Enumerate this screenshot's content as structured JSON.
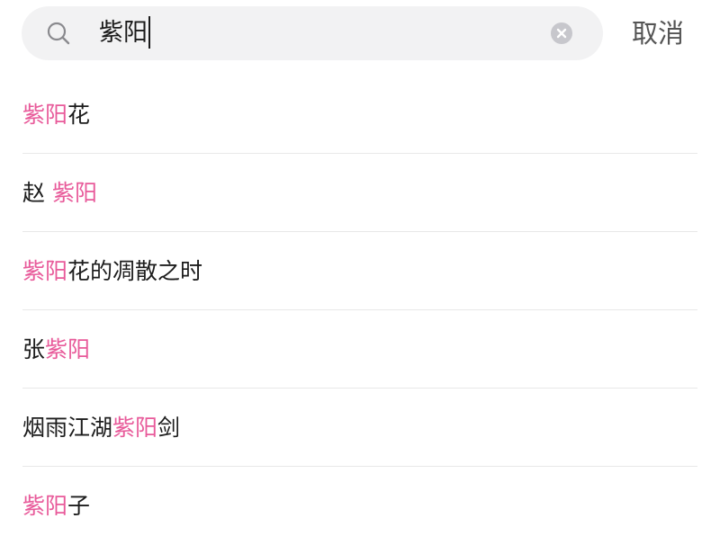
{
  "search": {
    "query": "紫阳",
    "cancel_label": "取消"
  },
  "colors": {
    "highlight": "#e85a9a",
    "text": "#1c1c1c",
    "search_bg": "#f2f2f3",
    "divider": "#e8e8e8"
  },
  "suggestions": [
    {
      "before": "",
      "match": "紫阳",
      "after": "花"
    },
    {
      "before": "赵 ",
      "match": "紫阳",
      "after": ""
    },
    {
      "before": "",
      "match": "紫阳",
      "after": "花的凋散之时"
    },
    {
      "before": "张",
      "match": "紫阳",
      "after": ""
    },
    {
      "before": "烟雨江湖",
      "match": "紫阳",
      "after": "剑"
    },
    {
      "before": "",
      "match": "紫阳",
      "after": "子"
    }
  ]
}
